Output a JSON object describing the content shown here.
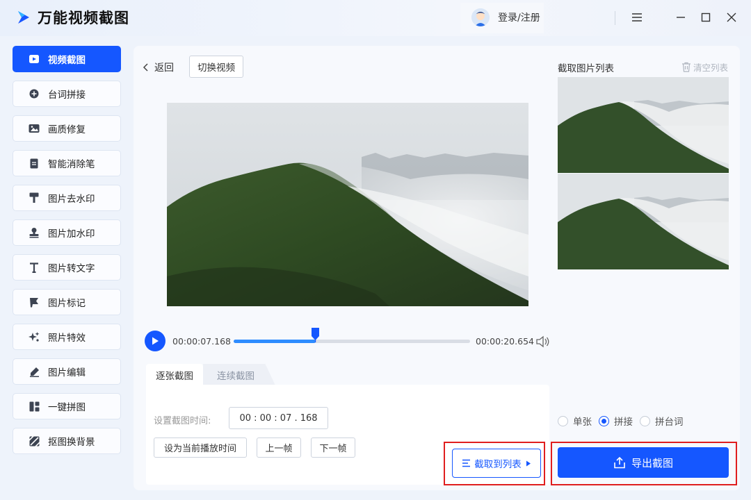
{
  "app": {
    "title": "万能视频截图",
    "login_label": "登录/注册"
  },
  "sidebar": {
    "items": [
      {
        "label": "视频截图",
        "icon": "video-screenshot-icon",
        "active": true
      },
      {
        "label": "台词拼接",
        "icon": "plus-circle-icon"
      },
      {
        "label": "画质修复",
        "icon": "image-icon"
      },
      {
        "label": "智能消除笔",
        "icon": "document-icon"
      },
      {
        "label": "图片去水印",
        "icon": "paint-roller-icon"
      },
      {
        "label": "图片加水印",
        "icon": "stamp-icon"
      },
      {
        "label": "图片转文字",
        "icon": "text-t-icon"
      },
      {
        "label": "图片标记",
        "icon": "flag-icon"
      },
      {
        "label": "照片特效",
        "icon": "sparkle-icon"
      },
      {
        "label": "图片编辑",
        "icon": "pen-icon"
      },
      {
        "label": "一键拼图",
        "icon": "collage-icon"
      },
      {
        "label": "抠图换背景",
        "icon": "stripes-icon"
      }
    ]
  },
  "toolbar": {
    "back_label": "返回",
    "switch_video_label": "切换视频"
  },
  "player": {
    "current_time": "00:00:07.168",
    "total_time": "00:00:20.654",
    "progress": 0.347
  },
  "tabs": {
    "single": "逐张截图",
    "continuous": "连续截图"
  },
  "capture_panel": {
    "time_label": "设置截图时间:",
    "time_value": "00 : 00 : 07 . 168",
    "set_current_label": "设为当前播放时间",
    "prev_frame_label": "上一帧",
    "next_frame_label": "下一帧",
    "capture_to_list_label": "截取到列表"
  },
  "image_list": {
    "title": "截取图片列表",
    "clear_label": "清空列表",
    "count": 2
  },
  "export": {
    "modes": [
      {
        "label": "单张",
        "selected": false
      },
      {
        "label": "拼接",
        "selected": true
      },
      {
        "label": "拼台词",
        "selected": false
      }
    ],
    "export_label": "导出截图"
  },
  "colors": {
    "accent": "#1557ff",
    "highlight": "#e01e1e",
    "progress": "#2e8cff"
  }
}
